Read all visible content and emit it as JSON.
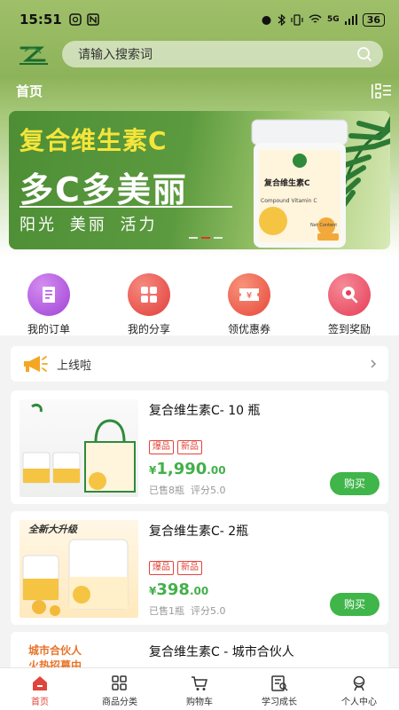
{
  "status_bar": {
    "time": "15:51",
    "battery": "36",
    "network": "5G"
  },
  "search": {
    "placeholder": "请输入搜索词"
  },
  "header": {
    "title": "首页"
  },
  "banner": {
    "title1": "复合维生素C",
    "title2": "多C多美丽",
    "title3": "阳光 美丽 活力",
    "jar_label": "复合维生素C",
    "jar_sub": "Compound Vitamin C",
    "jar_net": "Net Content"
  },
  "quick_actions": [
    {
      "label": "我的订单",
      "icon": "order-icon",
      "color": "#b455e0"
    },
    {
      "label": "我的分享",
      "icon": "share-grid-icon",
      "color": "#e84d4a"
    },
    {
      "label": "领优惠券",
      "icon": "coupon-icon",
      "color": "#ef5a45"
    },
    {
      "label": "签到奖励",
      "icon": "signin-icon",
      "color": "#ee4f63"
    }
  ],
  "notice": {
    "text": "上线啦"
  },
  "products": [
    {
      "name": "复合维生素C- 10 瓶",
      "tags": [
        "爆品",
        "新品"
      ],
      "currency": "¥",
      "price_int": "1,990",
      "price_dec": ".00",
      "sold": "已售8瓶",
      "rating": "评分5.0",
      "buy_label": "购买"
    },
    {
      "name": "复合维生素C- 2瓶",
      "tags": [
        "爆品",
        "新品"
      ],
      "currency": "¥",
      "price_int": "398",
      "price_dec": ".00",
      "sold": "已售1瓶",
      "rating": "评分5.0",
      "buy_label": "购买",
      "image_caption": "全新大升级"
    },
    {
      "name": "复合维生素C - 城市合伙人",
      "image_caption1": "城市合伙人",
      "image_caption2": "火热招募中"
    }
  ],
  "tabs": [
    {
      "label": "首页",
      "icon": "home-icon",
      "active": true
    },
    {
      "label": "商品分类",
      "icon": "category-icon",
      "active": false
    },
    {
      "label": "购物车",
      "icon": "cart-icon",
      "active": false
    },
    {
      "label": "学习成长",
      "icon": "learn-icon",
      "active": false
    },
    {
      "label": "个人中心",
      "icon": "profile-icon",
      "active": false
    }
  ],
  "colors": {
    "accent_green": "#3fb54a",
    "tag_red": "#e0453b",
    "banner_yellow": "#f5e53a"
  }
}
